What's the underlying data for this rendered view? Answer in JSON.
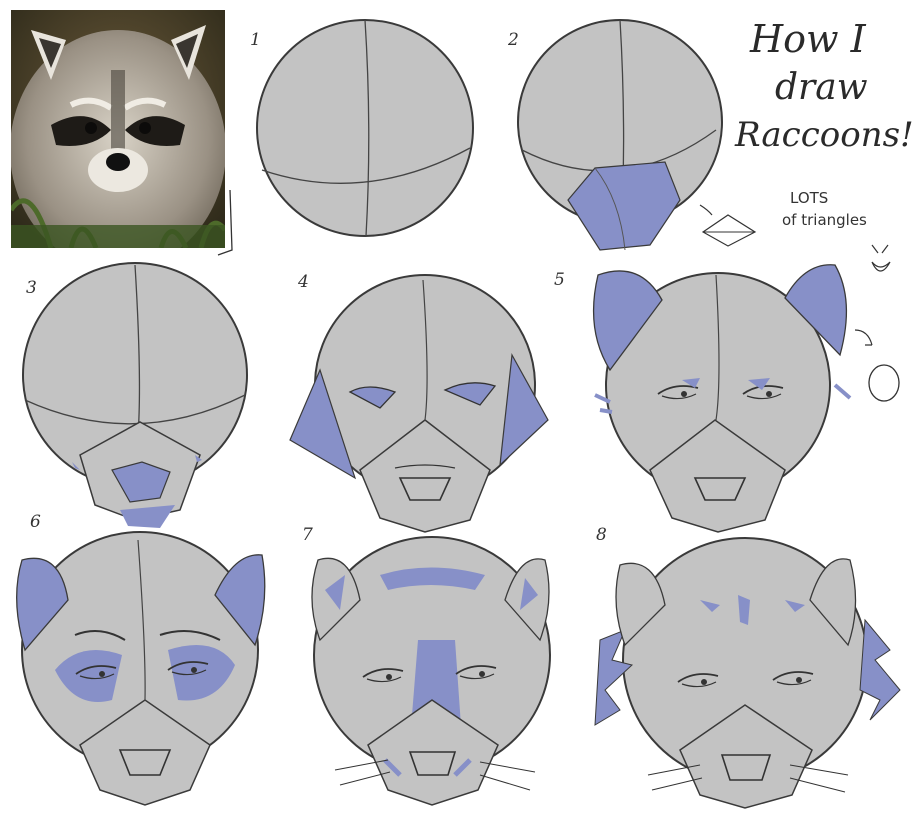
{
  "title": {
    "line1": "How I",
    "line2": "draw",
    "line3": "Raccoons!",
    "subtitle_line1": "LOTS",
    "subtitle_line2": "of triangles"
  },
  "steps": [
    "1",
    "2",
    "3",
    "4",
    "5",
    "6",
    "7",
    "8"
  ],
  "colors": {
    "background": "#ffffff",
    "head_fill": "#c3c3c3",
    "accent_blue": "#8790c8",
    "line": "#3a3a3a"
  },
  "reference_photo": {
    "subject": "raccoon face photo"
  }
}
